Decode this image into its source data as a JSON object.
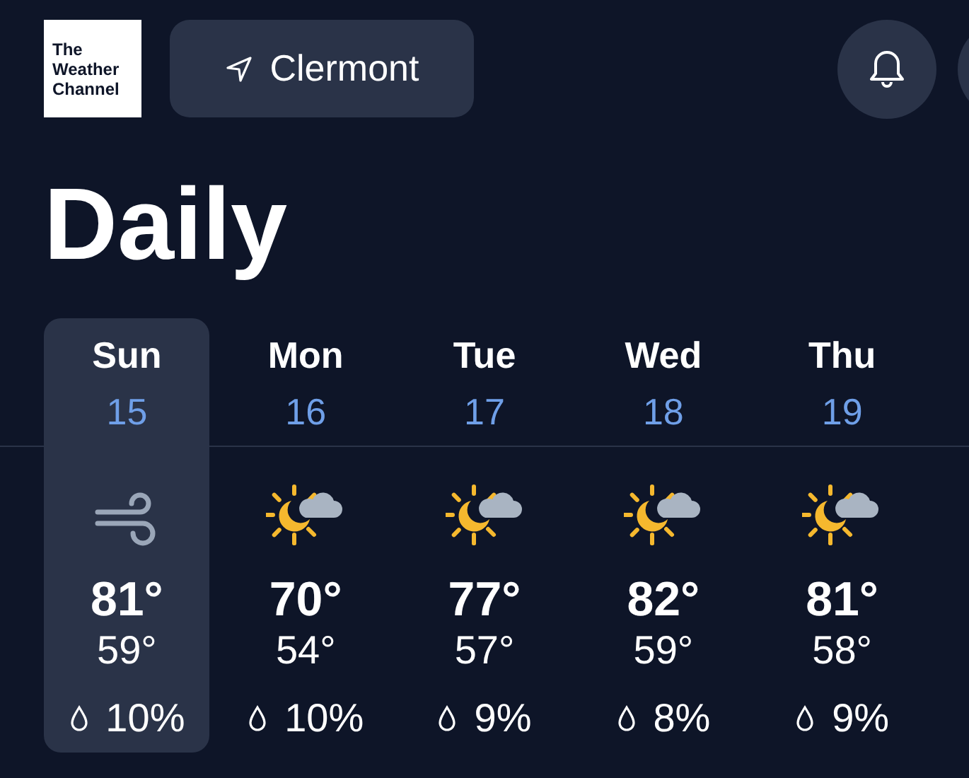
{
  "logo": {
    "lines": [
      "The",
      "Weather",
      "Channel"
    ]
  },
  "location": {
    "label": "Clermont"
  },
  "title": "Daily",
  "days": [
    {
      "day": "Sun",
      "date": "15",
      "selected": true,
      "kind": "wind",
      "high": "81°",
      "low": "59°",
      "precip": "10%"
    },
    {
      "day": "Mon",
      "date": "16",
      "selected": false,
      "kind": "partly_cloudy",
      "high": "70°",
      "low": "54°",
      "precip": "10%"
    },
    {
      "day": "Tue",
      "date": "17",
      "selected": false,
      "kind": "partly_cloudy",
      "high": "77°",
      "low": "57°",
      "precip": "9%"
    },
    {
      "day": "Wed",
      "date": "18",
      "selected": false,
      "kind": "partly_cloudy",
      "high": "82°",
      "low": "59°",
      "precip": "8%"
    },
    {
      "day": "Thu",
      "date": "19",
      "selected": false,
      "kind": "partly_cloudy",
      "high": "81°",
      "low": "58°",
      "precip": "9%"
    }
  ]
}
